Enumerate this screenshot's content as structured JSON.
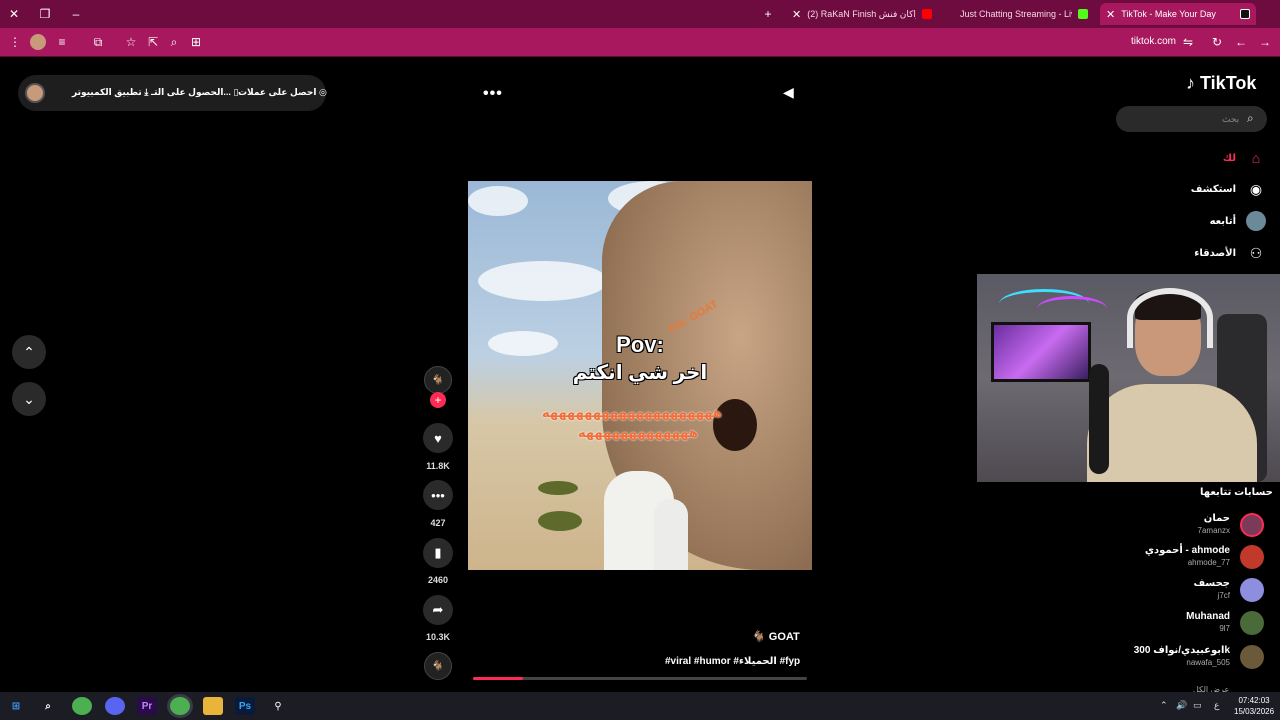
{
  "browser": {
    "tabs": [
      {
        "title": "TikTok - Make Your Day",
        "active": true
      },
      {
        "title": "Just Chatting Streaming - Live S",
        "active": false
      },
      {
        "title": "(2) RaKaN Finish راكان فنش - Yo",
        "active": false
      }
    ],
    "url": "tiktok.com",
    "new_tab": "+"
  },
  "topbar": {
    "get_coins": "احصل على عملات",
    "get_app": "الحصول على التـ...",
    "desktop_app": "تطبيق الكمبيوتر"
  },
  "sidebar": {
    "logo": "TikTok",
    "search_placeholder": "بحث",
    "nav": [
      {
        "label": "لك",
        "icon": "home-icon",
        "active": true
      },
      {
        "label": "استكشف",
        "icon": "explore-icon"
      },
      {
        "label": "أتابعه",
        "icon": "following-icon"
      },
      {
        "label": "الأصدقاء",
        "icon": "friends-icon"
      }
    ],
    "following_title": "حسابات تتابعها",
    "following": [
      {
        "name": "حمان",
        "handle": "7amanzx",
        "color": "#7a3a5a"
      },
      {
        "name": "أحمودي - ahmode",
        "handle": "ahmode_77",
        "color": "#c0392b"
      },
      {
        "name": "جحسف",
        "handle": "j7cf",
        "color": "#8e8ee0"
      },
      {
        "name": "Muhanad",
        "handle": "9l7",
        "color": "#4a6a3a"
      },
      {
        "name": "ابوعبيدي/نواف 300k",
        "handle": "nawafa_505",
        "color": "#6a5a3a"
      }
    ],
    "see_all": "عرض الكل"
  },
  "video": {
    "overlay_pov": "Pov:",
    "overlay_arabic": "اخر شي انكتم",
    "overlay_laugh1": "ههههههههههههههههههههه",
    "overlay_laugh2": "هههههههههههههه",
    "overlay_goat": "Kik: GOAT",
    "author": "GOAT",
    "tags": "#viral #humor #الحميلاء #fyp",
    "progress": 0.15
  },
  "actions": {
    "likes": "11.8K",
    "comments": "427",
    "saves": "2460",
    "shares": "10.3K"
  },
  "taskbar": {
    "time": "07:42:03",
    "date": "15/03/2026",
    "lang": "ع"
  }
}
